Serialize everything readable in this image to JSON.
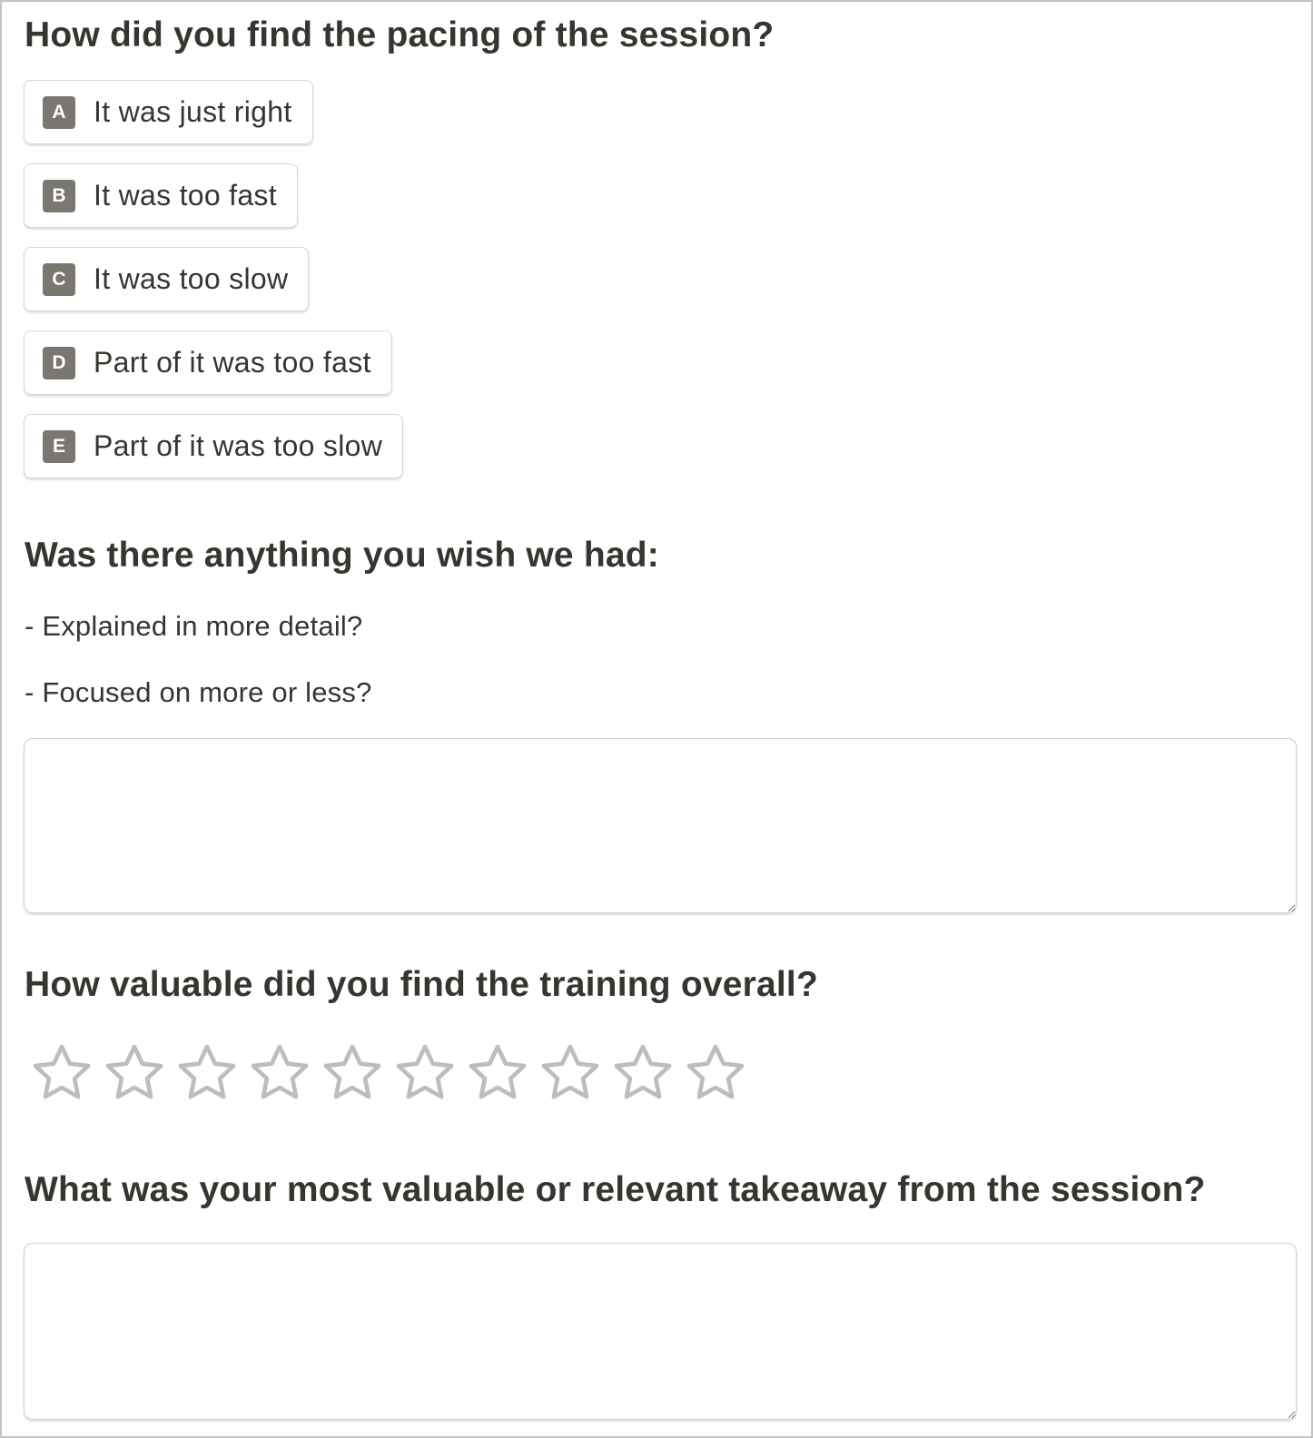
{
  "questions": [
    {
      "title": "How did you find the pacing of the session?",
      "type": "multiple-choice",
      "options": [
        {
          "key": "A",
          "label": "It was just right"
        },
        {
          "key": "B",
          "label": "It was too fast"
        },
        {
          "key": "C",
          "label": "It was too slow"
        },
        {
          "key": "D",
          "label": "Part of it was too fast"
        },
        {
          "key": "E",
          "label": "Part of it was too slow"
        }
      ]
    },
    {
      "title": "Was there anything you wish we had:",
      "type": "long-text",
      "hints": [
        "- Explained in more detail?",
        "- Focused on more or less?"
      ],
      "value": "",
      "placeholder": ""
    },
    {
      "title": "How valuable did you find the training overall?",
      "type": "rating",
      "max_rating": 10,
      "value": 0,
      "star_icon": "star-outline-icon",
      "colors": {
        "star_empty": "#bdbdbd"
      }
    },
    {
      "title": "What was your most valuable or relevant takeaway from the session?",
      "type": "long-text",
      "value": "",
      "placeholder": ""
    }
  ],
  "colors": {
    "text": "#37352f",
    "option_key_bg": "#79776f",
    "border": "#d6d6d6",
    "frame_border": "#c3c3c3"
  }
}
